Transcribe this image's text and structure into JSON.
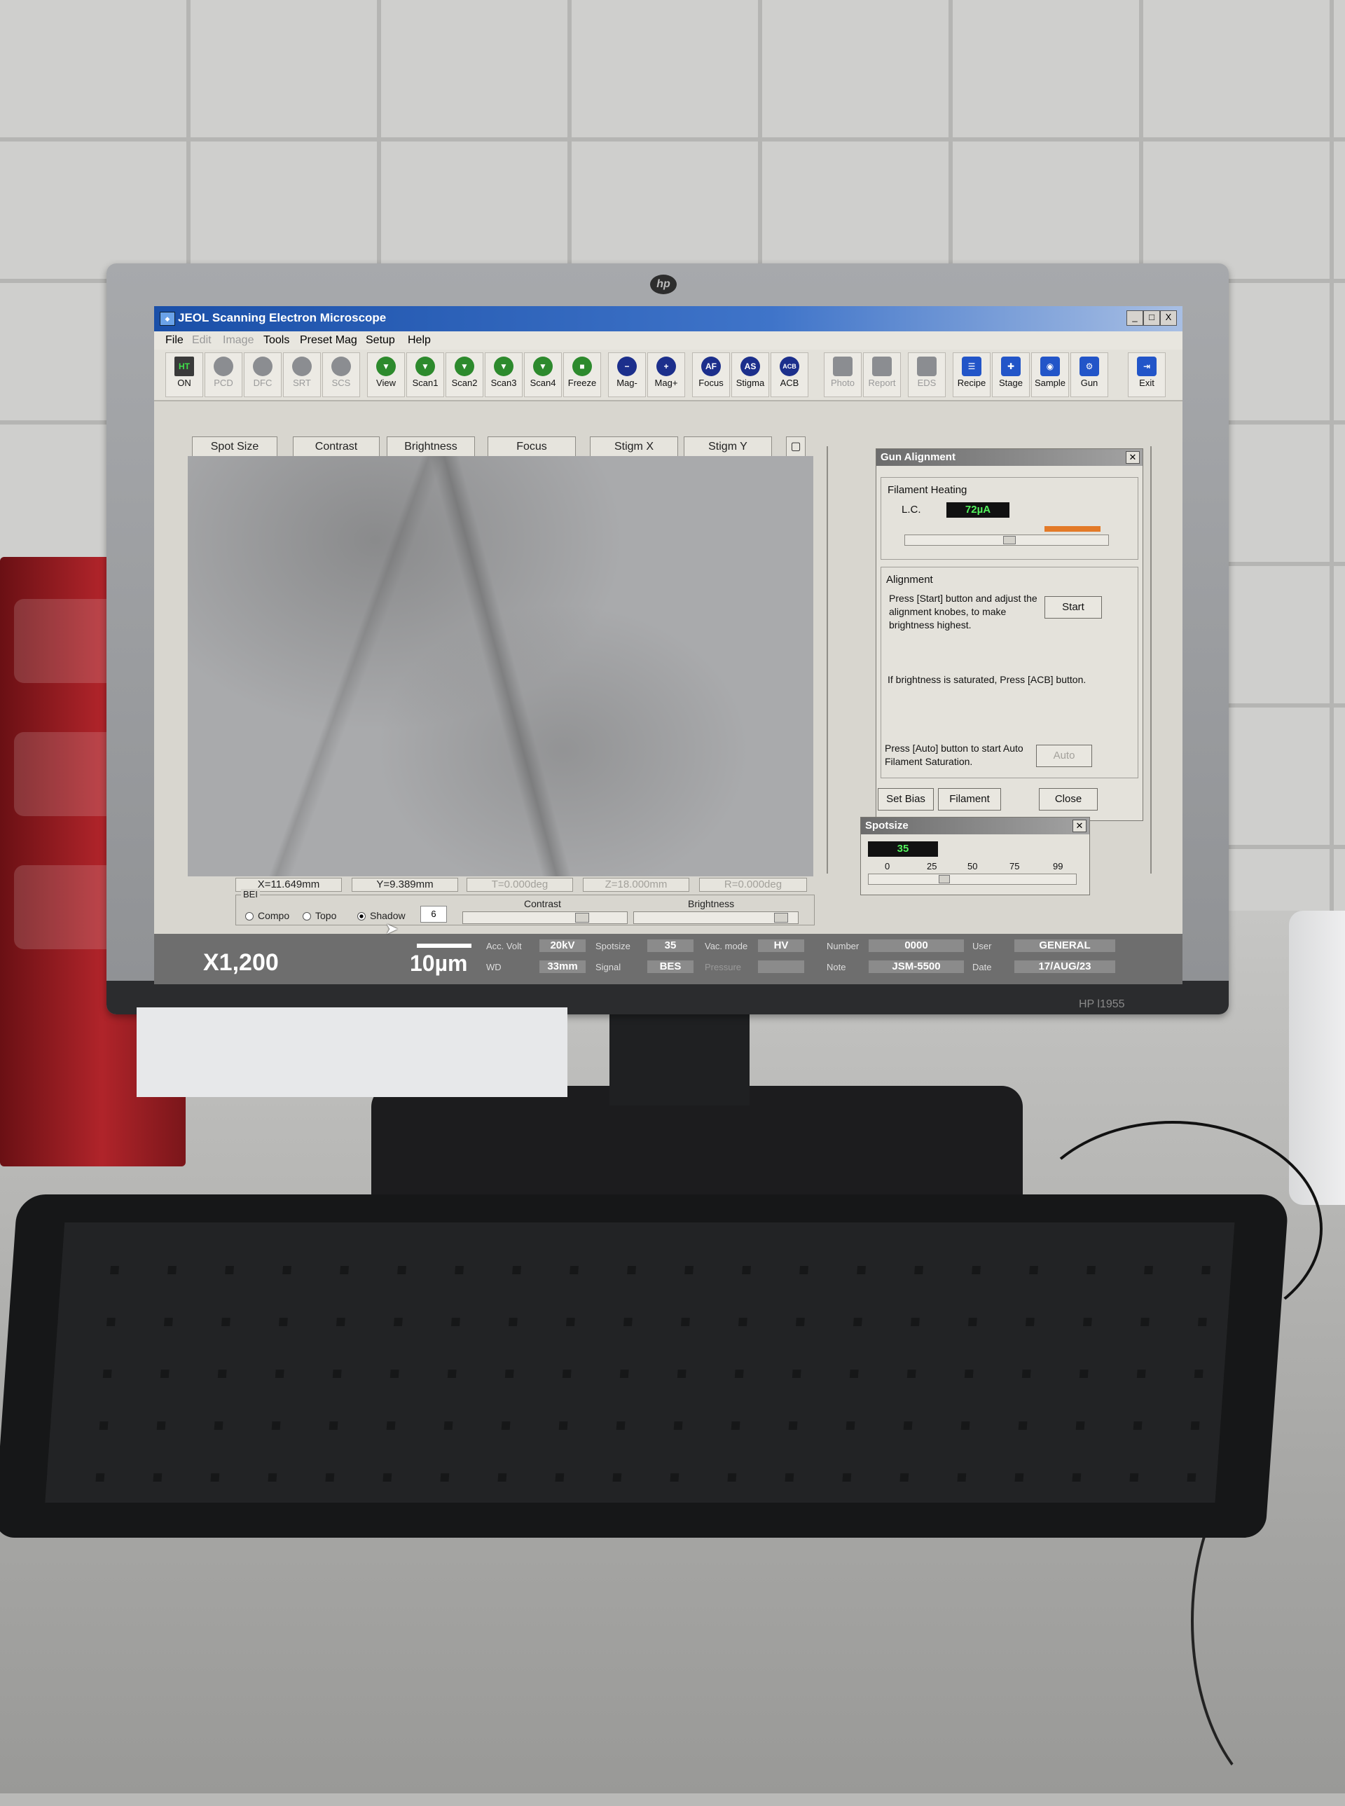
{
  "window": {
    "title": "JEOL Scanning Electron Microscope",
    "controls": [
      "_",
      "□",
      "X"
    ]
  },
  "menu": [
    "File",
    "Edit",
    "Image",
    "Tools",
    "Preset Mag",
    "Setup",
    "Help"
  ],
  "toolbar": [
    {
      "label": "ON",
      "icon": "ht-icon",
      "badge": "HT"
    },
    {
      "label": "PCD",
      "icon": "pcd-icon"
    },
    {
      "label": "DFC",
      "icon": "dfc-icon"
    },
    {
      "label": "SRT",
      "icon": "srt-icon"
    },
    {
      "label": "SCS",
      "icon": "scs-icon"
    },
    {
      "label": "View",
      "icon": "view-icon"
    },
    {
      "label": "Scan1",
      "icon": "scan1-icon"
    },
    {
      "label": "Scan2",
      "icon": "scan2-icon"
    },
    {
      "label": "Scan3",
      "icon": "scan3-icon"
    },
    {
      "label": "Scan4",
      "icon": "scan4-icon"
    },
    {
      "label": "Freeze",
      "icon": "freeze-icon"
    },
    {
      "label": "Mag-",
      "icon": "mag-minus-icon",
      "badge": "−"
    },
    {
      "label": "Mag+",
      "icon": "mag-plus-icon",
      "badge": "+"
    },
    {
      "label": "Focus",
      "icon": "focus-icon",
      "badge": "AF"
    },
    {
      "label": "Stigma",
      "icon": "stigma-icon",
      "badge": "AS"
    },
    {
      "label": "ACB",
      "icon": "acb-icon",
      "badge": "ACB"
    },
    {
      "label": "Photo",
      "icon": "photo-icon"
    },
    {
      "label": "Report",
      "icon": "report-icon"
    },
    {
      "label": "EDS",
      "icon": "eds-icon"
    },
    {
      "label": "Recipe",
      "icon": "recipe-icon"
    },
    {
      "label": "Stage",
      "icon": "stage-icon"
    },
    {
      "label": "Sample",
      "icon": "sample-icon"
    },
    {
      "label": "Gun",
      "icon": "gun-icon"
    },
    {
      "label": "Exit",
      "icon": "exit-icon"
    }
  ],
  "function_buttons": [
    "Spot Size",
    "Contrast",
    "Brightness",
    "Focus",
    "Stigm X",
    "Stigm Y"
  ],
  "coords": {
    "x": "X=11.649mm",
    "y": "Y=9.389mm",
    "t": "T=0.000deg",
    "z": "Z=18.000mm",
    "r": "R=0.000deg"
  },
  "bei": {
    "label": "BEI",
    "modes": [
      "Compo",
      "Topo",
      "Shadow"
    ],
    "selected": "Shadow",
    "shadow_value": "6",
    "contrast_label": "Contrast",
    "brightness_label": "Brightness"
  },
  "status": {
    "magnification": "X1,200",
    "scale": "10µm",
    "acc_volt_label": "Acc. Volt",
    "acc_volt": "20kV",
    "wd_label": "WD",
    "wd": "33mm",
    "spotsize_label": "Spotsize",
    "spotsize": "35",
    "signal_label": "Signal",
    "signal": "BES",
    "vac_label": "Vac. mode",
    "vac": "HV",
    "pressure_label": "Pressure",
    "number_label": "Number",
    "number": "0000",
    "note_label": "Note",
    "note": "JSM-5500",
    "user_label": "User",
    "user": "GENERAL",
    "date_label": "Date",
    "date": "17/AUG/23"
  },
  "gun_alignment": {
    "title": "Gun Alignment",
    "filament_heating": "Filament Heating",
    "lc_label": "L.C.",
    "lc_value": "72µA",
    "alignment": "Alignment",
    "instructions_1": "Press [Start] button and adjust the alignment knobes, to make brightness highest.",
    "instructions_2": "If brightness is saturated, Press [ACB] button.",
    "instructions_3": "Press [Auto] button to start Auto Filament Saturation.",
    "start": "Start",
    "auto": "Auto",
    "set_bias": "Set Bias",
    "filament": "Filament",
    "close": "Close"
  },
  "spotsize_panel": {
    "title": "Spotsize",
    "value": "35",
    "ticks": [
      "0",
      "25",
      "50",
      "75",
      "99"
    ]
  },
  "monitor_model": "HP l1955"
}
